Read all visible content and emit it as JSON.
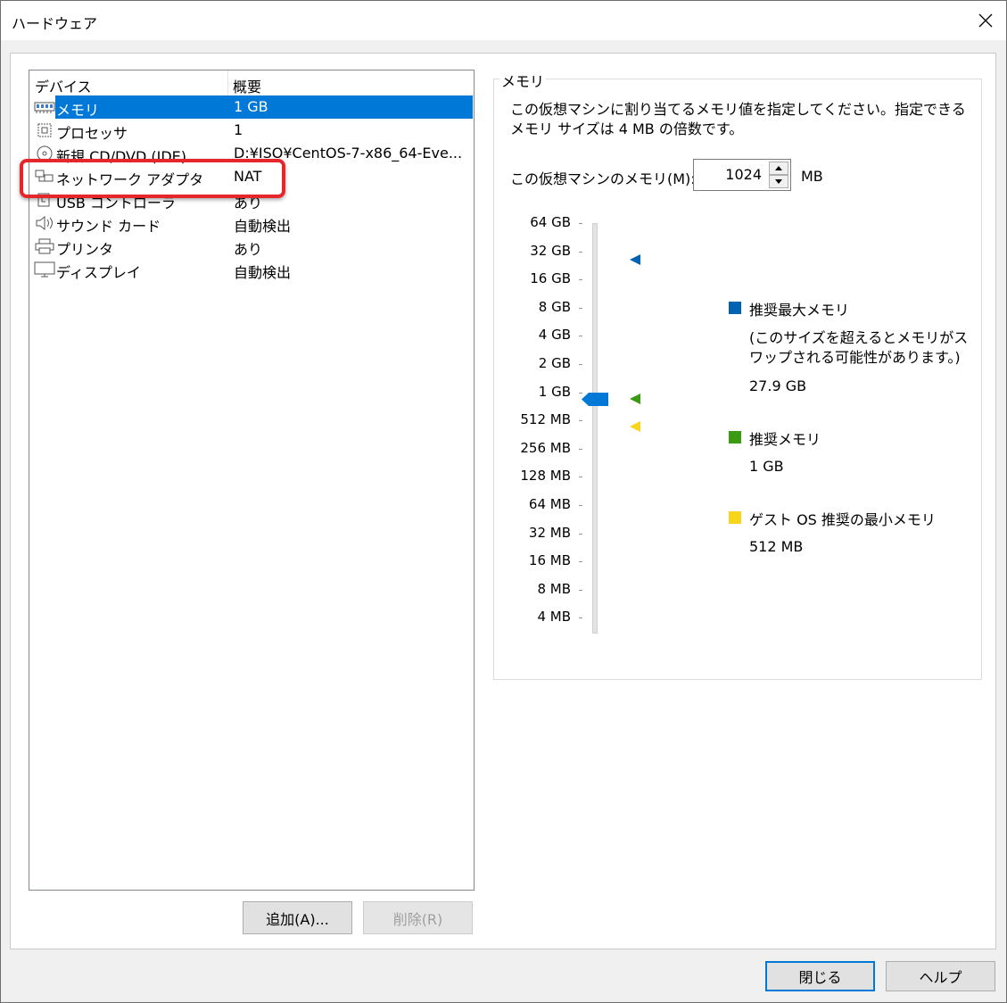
{
  "window": {
    "title": "ハードウェア"
  },
  "devices": {
    "header_device": "デバイス",
    "header_summary": "概要",
    "items": [
      {
        "icon": "memory-icon",
        "label": "メモリ",
        "summary": "1 GB"
      },
      {
        "icon": "processor-icon",
        "label": "プロセッサ",
        "summary": "1"
      },
      {
        "icon": "cd-dvd-icon",
        "label": "新規 CD/DVD (IDE)",
        "summary": "D:¥ISO¥CentOS-7-x86_64-Eve..."
      },
      {
        "icon": "network-adapter-icon",
        "label": "ネットワーク アダプタ",
        "summary": "NAT"
      },
      {
        "icon": "usb-controller-icon",
        "label": "USB コントローラ",
        "summary": "あり"
      },
      {
        "icon": "sound-card-icon",
        "label": "サウンド カード",
        "summary": "自動検出"
      },
      {
        "icon": "printer-icon",
        "label": "プリンタ",
        "summary": "あり"
      },
      {
        "icon": "display-icon",
        "label": "ディスプレイ",
        "summary": "自動検出"
      }
    ],
    "selected_index": 0,
    "highlighted_index": 3
  },
  "buttons": {
    "add": "追加(A)...",
    "remove": "削除(R)",
    "close": "閉じる",
    "help": "ヘルプ"
  },
  "memory": {
    "group_title": "メモリ",
    "description": "この仮想マシンに割り当てるメモリ値を指定してください。指定できるメモリ サイズは 4 MB の倍数です。",
    "field_label": "この仮想マシンのメモリ(M):",
    "value": "1024",
    "unit": "MB",
    "scale": [
      "64 GB",
      "32 GB",
      "16 GB",
      "8 GB",
      "4 GB",
      "2 GB",
      "1 GB",
      "512 MB",
      "256 MB",
      "128 MB",
      "64 MB",
      "32 MB",
      "16 MB",
      "8 MB",
      "4 MB"
    ],
    "slider_value": "1 GB",
    "legend": {
      "max_label": "推奨最大メモリ",
      "max_note": "(このサイズを超えるとメモリがスワップされる可能性があります。)",
      "max_value": "27.9 GB",
      "rec_label": "推奨メモリ",
      "rec_value": "1 GB",
      "min_label": "ゲスト OS 推奨の最小メモリ",
      "min_value": "512 MB"
    },
    "colors": {
      "max": "#0063b1",
      "rec": "#3a9a12",
      "min": "#f7d51a",
      "thumb": "#0078d7"
    }
  }
}
